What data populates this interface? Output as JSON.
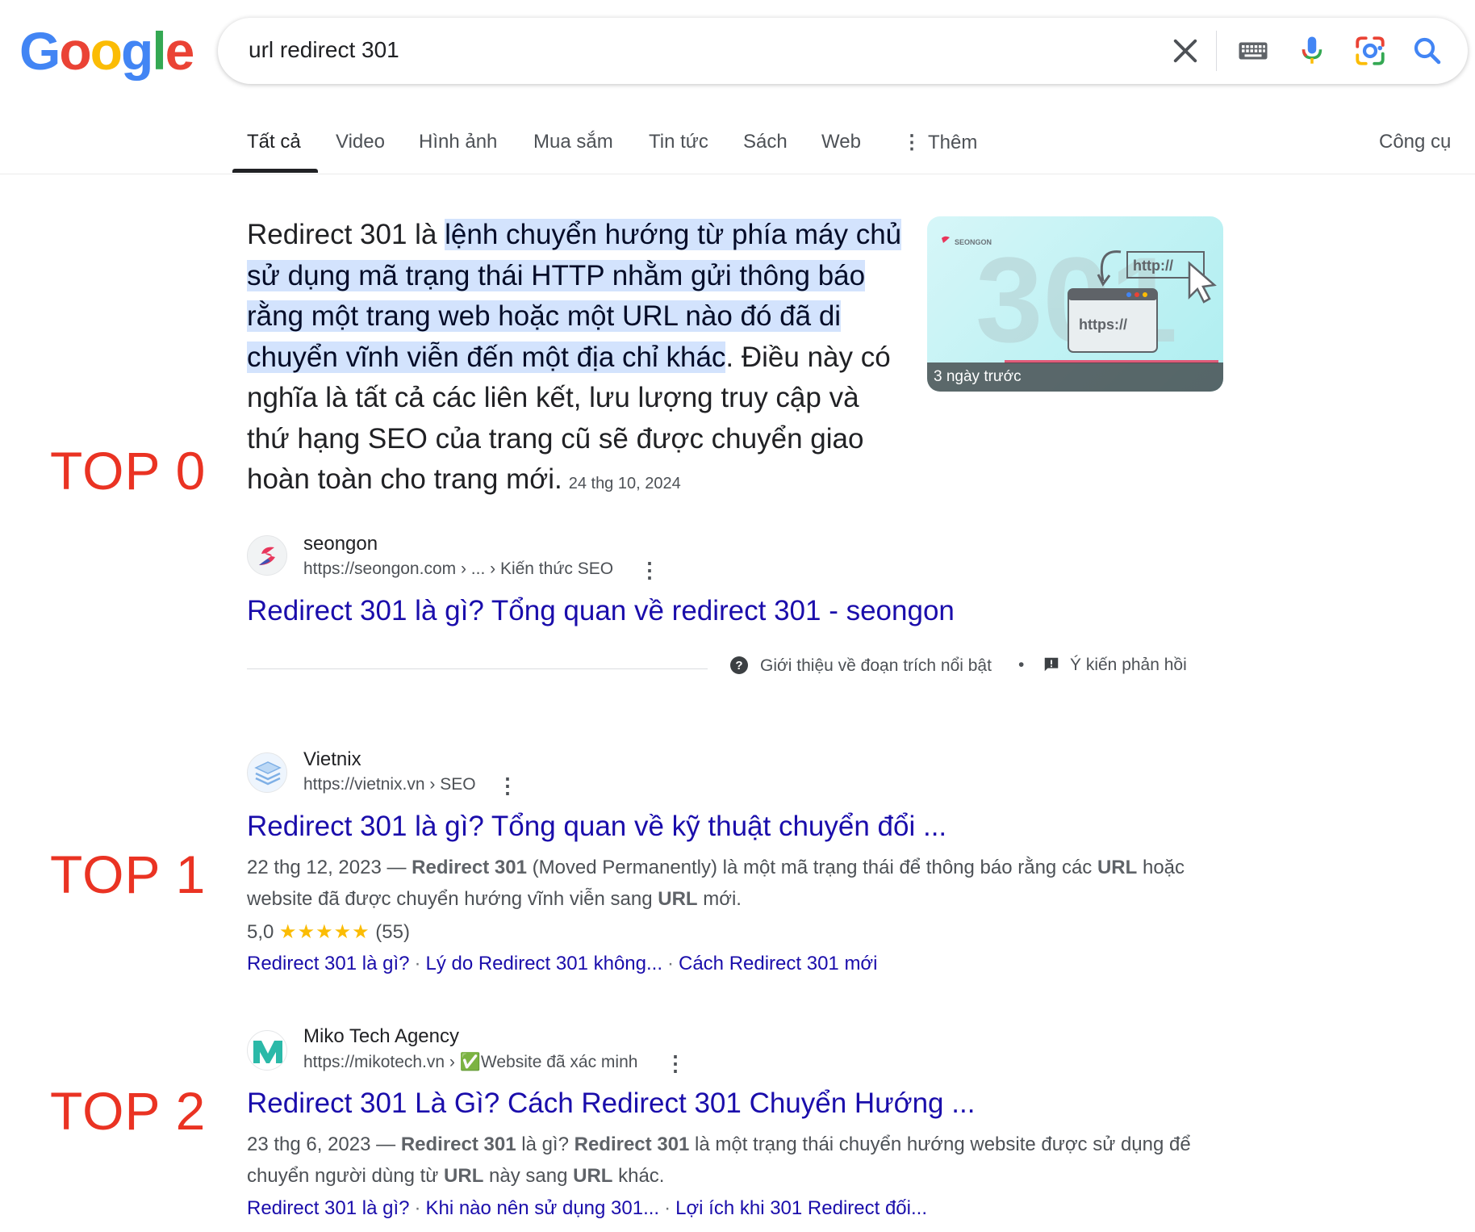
{
  "header": {
    "logo_letters": [
      {
        "ch": "G",
        "color": "#4285f4"
      },
      {
        "ch": "o",
        "color": "#ea4335"
      },
      {
        "ch": "o",
        "color": "#fbbc05"
      },
      {
        "ch": "g",
        "color": "#4285f4"
      },
      {
        "ch": "l",
        "color": "#34a853"
      },
      {
        "ch": "e",
        "color": "#ea4335"
      }
    ],
    "search_query": "url redirect 301",
    "icons": [
      "clear-icon",
      "keyboard-icon",
      "mic-icon",
      "lens-icon",
      "search-icon"
    ]
  },
  "tabs": {
    "all": "Tất cả",
    "video": "Video",
    "images": "Hình ảnh",
    "shopping": "Mua sắm",
    "news": "Tin tức",
    "books": "Sách",
    "web": "Web",
    "more": "Thêm",
    "tools": "Công cụ"
  },
  "labels": {
    "top0": "TOP 0",
    "top1": "TOP 1",
    "top2": "TOP 2"
  },
  "snippet": {
    "text_before": "Redirect 301 là ",
    "highlight": "lệnh chuyển hướng từ phía máy chủ sử dụng mã trạng thái HTTP nhằm gửi thông báo rằng một trang web hoặc một URL nào đó đã di chuyển vĩnh viễn đến một địa chỉ khác",
    "text_after": ". Điều này có nghĩa là tất cả các liên kết, lưu lượng truy cập và thứ hạng SEO của trang cũ sẽ được chuyển giao hoàn toàn cho trang mới.",
    "date": "24 thg 10, 2024",
    "thumbnail_caption": "3 ngày trước",
    "thumbnail_brand": "SEONGON",
    "thumbnail_http": "http://",
    "thumbnail_https": "https://",
    "thumbnail_number": "301",
    "source_name": "seongon",
    "source_url": "https://seongon.com › ... › Kiến thức SEO",
    "title": "Redirect 301 là gì? Tổng quan về redirect 301 - seongon",
    "about_text": "Giới thiệu về đoạn trích nổi bật",
    "bullet": "•",
    "feedback_text": "Ý kiến phản hồi"
  },
  "results": [
    {
      "site_name": "Vietnix",
      "url": "https://vietnix.vn › SEO",
      "title": "Redirect 301 là gì? Tổng quan về kỹ thuật chuyển đổi ...",
      "date": "22 thg 12, 2023",
      "dash": " — ",
      "desc_b1": "Redirect 301",
      "desc_t1": " (Moved Permanently) là một mã trạng thái để thông báo rằng các ",
      "desc_b2": "URL",
      "desc_t2": " hoặc website đã được chuyển hướng vĩnh viễn sang ",
      "desc_b3": "URL",
      "desc_t3": " mới.",
      "rating_value": "5,0",
      "stars": "★★★★★",
      "rating_count": "(55)",
      "sitelinks": [
        "Redirect 301 là gì?",
        "Lý do Redirect 301 không...",
        "Cách Redirect 301 mới"
      ],
      "sitelink_sep": "·"
    },
    {
      "site_name": "Miko Tech Agency",
      "url": "https://mikotech.vn ›",
      "verified_icon": "✅",
      "verified_text": "Website đã xác minh",
      "title": "Redirect 301 Là Gì? Cách Redirect 301 Chuyển Hướng ...",
      "date": "23 thg 6, 2023",
      "dash": " — ",
      "desc_b1": "Redirect 301",
      "desc_t1": " là gì? ",
      "desc_b2": "Redirect 301",
      "desc_t2": " là một trạng thái chuyển hướng website được sử dụng để chuyển người dùng từ ",
      "desc_b3": "URL",
      "desc_t3": " này sang ",
      "desc_b4": "URL",
      "desc_t4": " khác.",
      "sitelinks": [
        "Redirect 301 là gì?",
        "Khi nào nên sử dụng 301...",
        "Lợi ích khi 301 Redirect đối..."
      ],
      "sitelink_sep": "·"
    }
  ],
  "colors": {
    "link": "#1a0dab",
    "label_red": "#ea3323",
    "highlight_bg": "#d3e3fd",
    "star": "#fbbc04"
  }
}
